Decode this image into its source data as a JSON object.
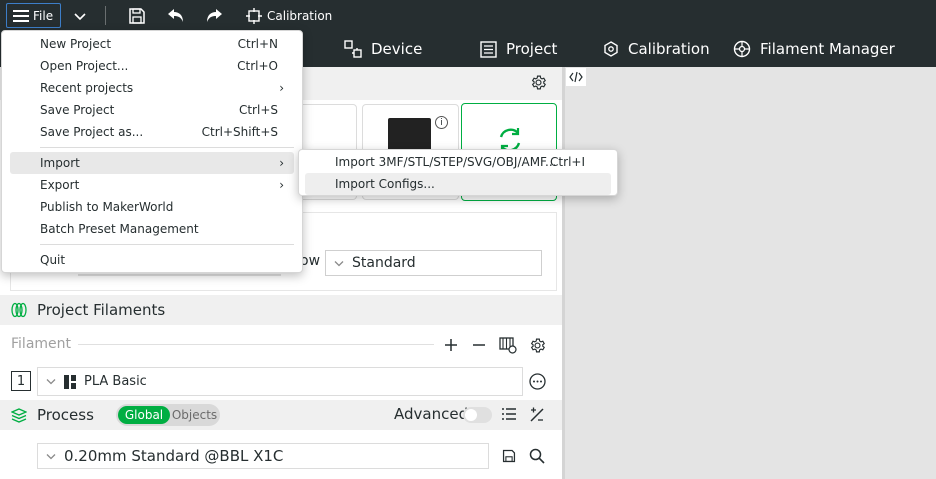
{
  "topbar": {
    "file_label": "File",
    "calibration_label": "Calibration"
  },
  "tabs": {
    "device": "Device",
    "project": "Project",
    "calibration": "Calibration",
    "filament_manager": "Filament Manager"
  },
  "file_menu": {
    "items": [
      {
        "label": "New Project",
        "shortcut": "Ctrl+N"
      },
      {
        "label": "Open Project...",
        "shortcut": "Ctrl+O"
      },
      {
        "label": "Recent projects",
        "shortcut": ""
      },
      {
        "label": "Save Project",
        "shortcut": "Ctrl+S"
      },
      {
        "label": "Save Project as...",
        "shortcut": "Ctrl+Shift+S"
      },
      {
        "label": "Import",
        "shortcut": ""
      },
      {
        "label": "Export",
        "shortcut": ""
      },
      {
        "label": "Publish to MakerWorld",
        "shortcut": ""
      },
      {
        "label": "Batch Preset Management",
        "shortcut": ""
      },
      {
        "label": "Quit",
        "shortcut": ""
      }
    ]
  },
  "import_submenu": {
    "items": [
      {
        "label": "Import 3MF/STL/STEP/SVG/OBJ/AMF...",
        "shortcut": "Ctrl+I"
      },
      {
        "label": "Import Configs...",
        "shortcut": ""
      }
    ]
  },
  "plate": {
    "partial_label": "ow",
    "plate_type_value": "Standard"
  },
  "filaments": {
    "section_title": "Project Filaments",
    "row_label": "Filament",
    "index": "1",
    "selected": "PLA Basic"
  },
  "process": {
    "section_title": "Process",
    "toggle_global": "Global",
    "toggle_objects": "Objects",
    "advanced_label": "Advanced",
    "preset_value": "0.20mm Standard @BBL X1C"
  },
  "colors": {
    "dark_bar": "#262e30",
    "accent_green": "#00ae42",
    "file_border": "#3d7ec8"
  }
}
